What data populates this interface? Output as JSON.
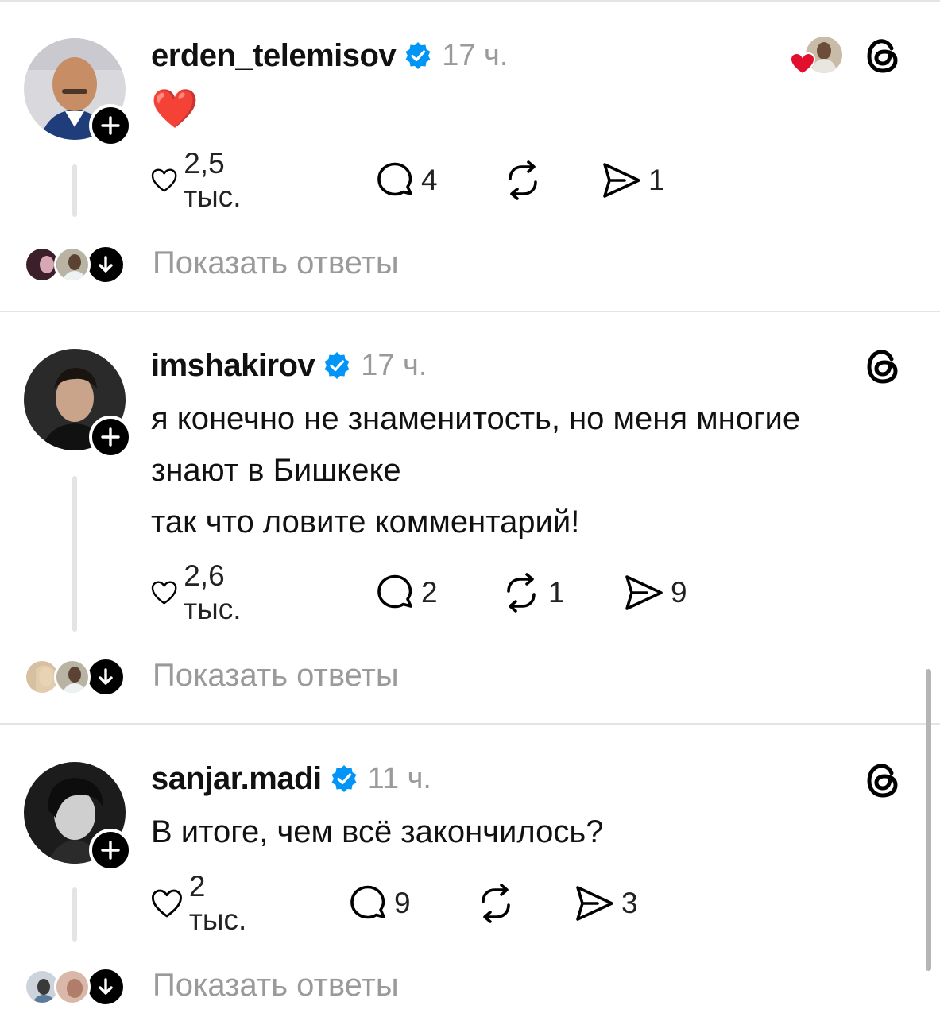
{
  "posts": [
    {
      "username": "erden_telemisov",
      "time": "17 ч.",
      "text_lines": [
        "❤️"
      ],
      "likes": "2,5 тыс.",
      "comments": "4",
      "reposts": "",
      "shares": "1",
      "show_replies": "Показать ответы"
    },
    {
      "username": "imshakirov",
      "time": "17 ч.",
      "text_lines": [
        "я конечно не знаменитость, но меня многие",
        "знают в Бишкеке",
        "так что ловите комментарий!"
      ],
      "likes": "2,6 тыс.",
      "comments": "2",
      "reposts": "1",
      "shares": "9",
      "show_replies": "Показать ответы"
    },
    {
      "username": "sanjar.madi",
      "time": "11 ч.",
      "text_lines": [
        "В итоге, чем всё закончилось?"
      ],
      "likes": "2 тыс.",
      "comments": "9",
      "reposts": "",
      "shares": "3",
      "show_replies": "Показать ответы"
    }
  ],
  "colors": {
    "verified": "#0095f6",
    "muted_text": "#9a9a9a",
    "divider": "#e4e4e4",
    "heart_red": "#e0102e"
  },
  "icons": [
    "verified-badge-icon",
    "threads-logo-icon",
    "heart-icon",
    "comment-icon",
    "repost-icon",
    "share-icon",
    "plus-icon",
    "arrow-down-icon"
  ]
}
